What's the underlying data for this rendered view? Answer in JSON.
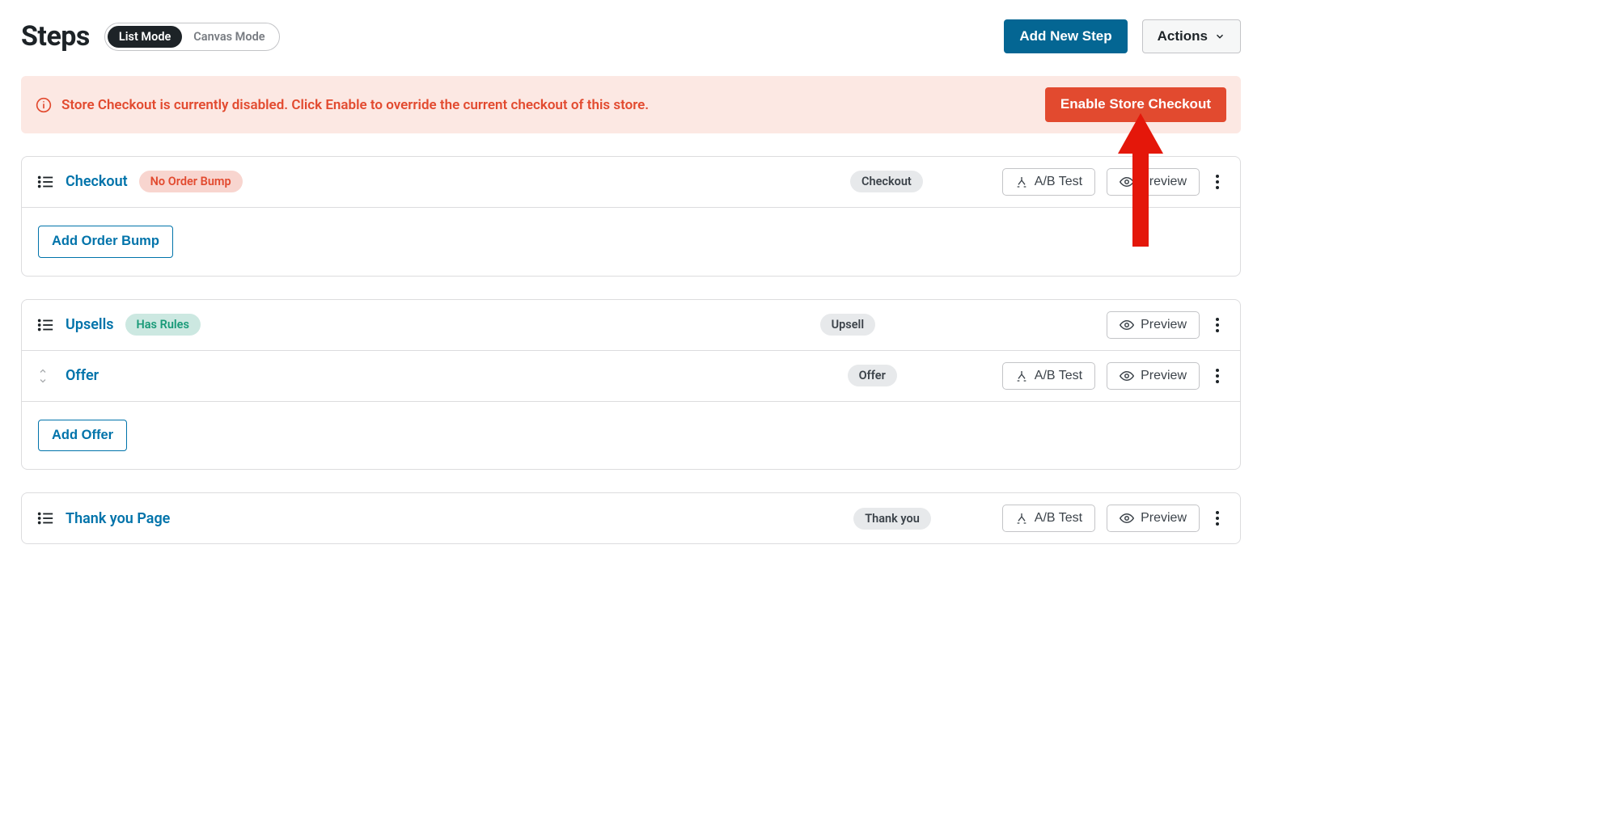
{
  "header": {
    "title": "Steps",
    "mode_list": "List Mode",
    "mode_canvas": "Canvas Mode",
    "add_step": "Add New Step",
    "actions": "Actions"
  },
  "banner": {
    "text": "Store Checkout is currently disabled. Click Enable to override the current checkout of this store.",
    "cta": "Enable Store Checkout"
  },
  "labels": {
    "ab_test": "A/B Test",
    "preview": "Preview"
  },
  "steps": {
    "checkout": {
      "title": "Checkout",
      "status": "No Order Bump",
      "type": "Checkout",
      "add": "Add Order Bump"
    },
    "upsells": {
      "title": "Upsells",
      "status": "Has Rules",
      "type": "Upsell",
      "offer_title": "Offer",
      "offer_type": "Offer",
      "add": "Add Offer"
    },
    "thankyou": {
      "title": "Thank you Page",
      "type": "Thank you"
    }
  }
}
